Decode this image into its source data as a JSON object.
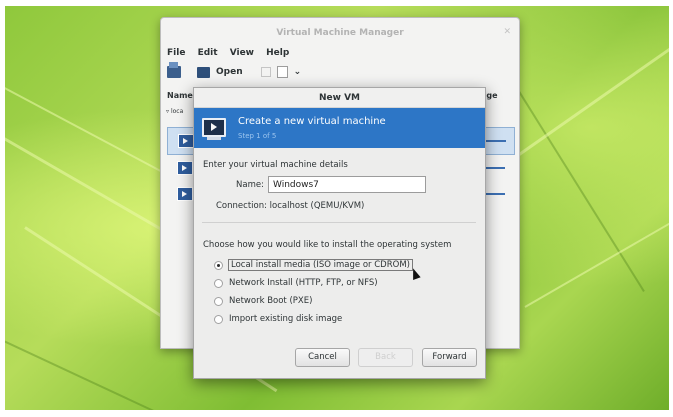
{
  "main_window": {
    "title": "Virtual Machine Manager",
    "menu": [
      "File",
      "Edit",
      "View",
      "Help"
    ],
    "toolbar_open_label": "Open",
    "column_name": "Name",
    "column_right": "age",
    "group_label": "loca"
  },
  "dialog": {
    "title": "New VM",
    "banner_title": "Create a new virtual machine",
    "banner_step": "Step 1 of 5",
    "section_details": "Enter your virtual machine details",
    "name_label": "Name:",
    "name_value": "Windows7",
    "connection_label": "Connection:",
    "connection_value": "localhost (QEMU/KVM)",
    "section_install": "Choose how you would like to install the operating system",
    "options": [
      {
        "label": "Local install media (ISO image or CDROM)",
        "selected": true
      },
      {
        "label": "Network Install (HTTP, FTP, or NFS)",
        "selected": false
      },
      {
        "label": "Network Boot (PXE)",
        "selected": false
      },
      {
        "label": "Import existing disk image",
        "selected": false
      }
    ],
    "buttons": {
      "cancel": "Cancel",
      "back": "Back",
      "forward": "Forward"
    }
  },
  "colors": {
    "banner": "#2d76c6",
    "wallpaper": "#8fc83c"
  }
}
